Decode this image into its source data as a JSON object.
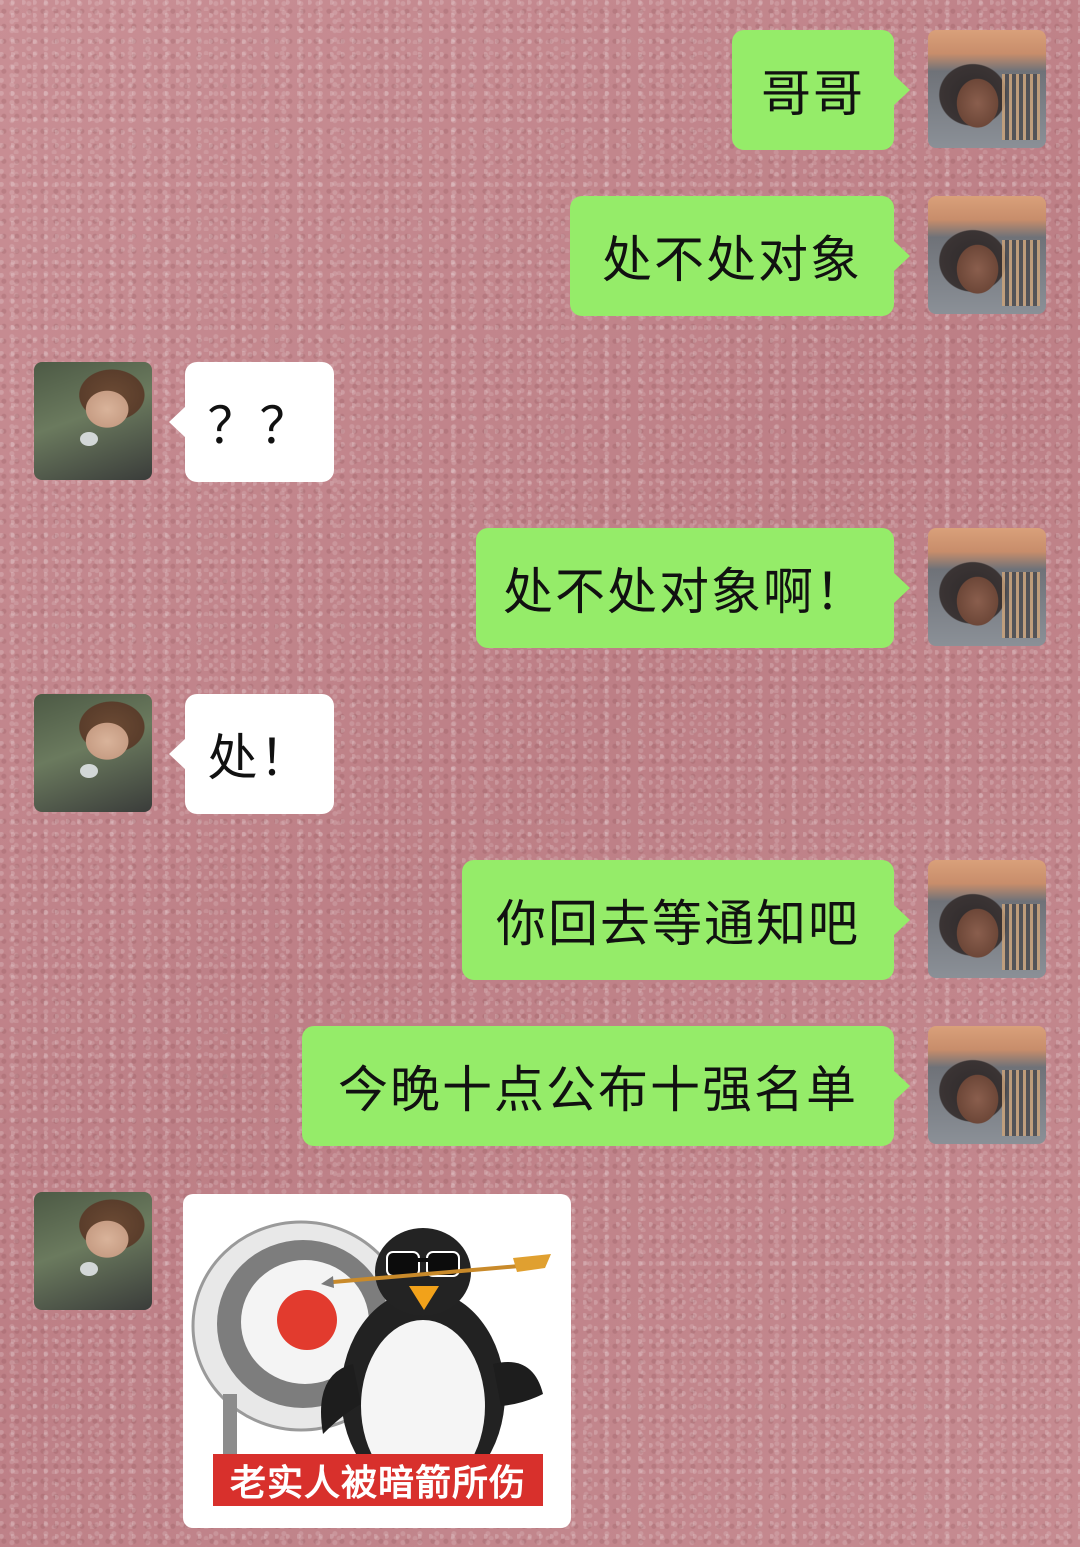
{
  "messages": [
    {
      "side": "me",
      "text": "哥哥"
    },
    {
      "side": "me",
      "text": "处不处对象"
    },
    {
      "side": "other",
      "text": "？？"
    },
    {
      "side": "me",
      "text": "处不处对象啊！"
    },
    {
      "side": "other",
      "text": "处！"
    },
    {
      "side": "me",
      "text": "你回去等通知吧"
    },
    {
      "side": "me",
      "text": "今晚十点公布十强名单"
    },
    {
      "side": "other",
      "type": "sticker",
      "caption": "老实人被暗箭所伤",
      "image": "penguin-archery-target-sticker"
    }
  ],
  "colors": {
    "my_bubble": "#95ec69",
    "other_bubble": "#ffffff",
    "background": "#c4878d",
    "caption_bg": "#d8302c"
  }
}
